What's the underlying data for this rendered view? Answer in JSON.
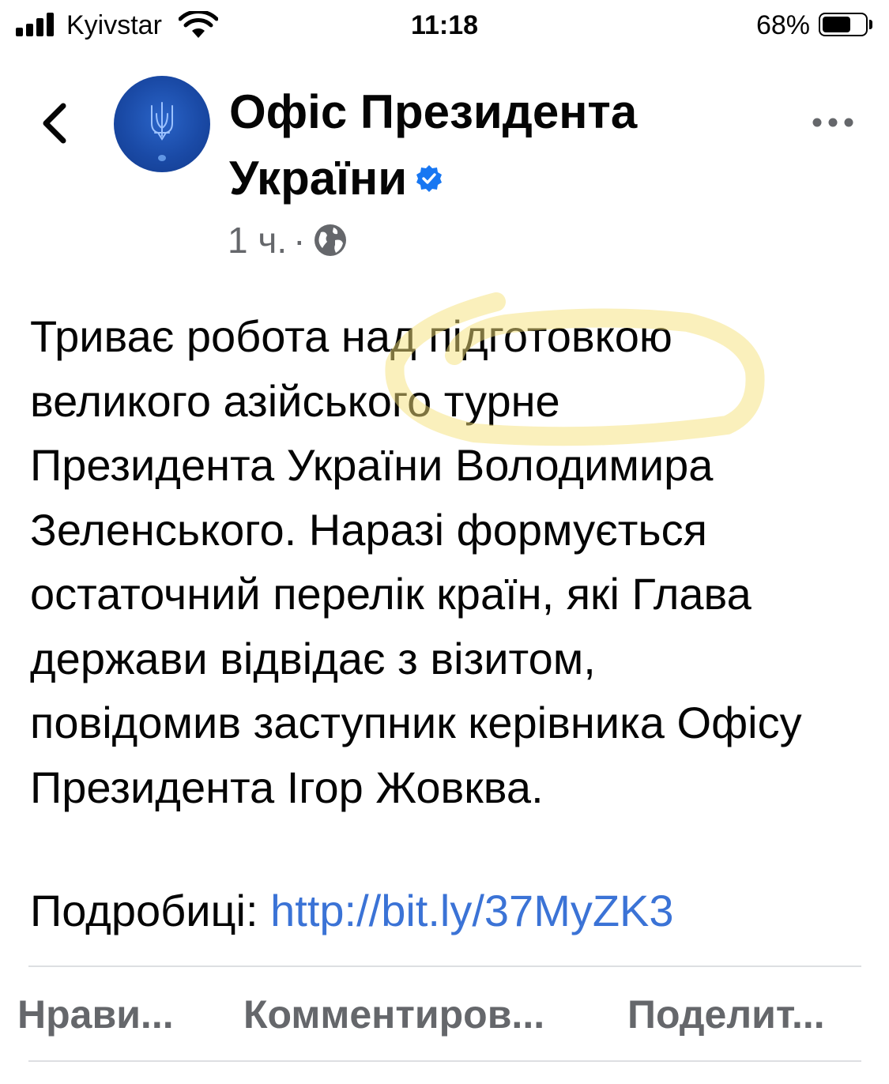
{
  "status_bar": {
    "carrier": "Kyivstar",
    "time": "11:18",
    "battery_percent": "68%",
    "battery_level": 0.68,
    "signal_bars": 4,
    "wifi_icon": "wifi-icon"
  },
  "header": {
    "back_icon": "chevron-left-icon",
    "page_name_line1": "Офіс Президента",
    "page_name_line2": "України",
    "verified_icon": "verified-badge-icon",
    "time_ago": "1 ч.",
    "separator": "·",
    "audience_icon": "globe-icon",
    "more_icon": "more-horizontal-icon"
  },
  "post": {
    "lines": [
      "Триває робота над підготовкою",
      "великого азійського турне",
      "Президента України Володимира",
      "Зеленського. Наразі формується",
      "остаточний перелік країн, які Глава",
      "держави відвідає з візитом,",
      "повідомив заступник керівника Офісу",
      "Президента Ігор Жовква."
    ],
    "details_label": "Подробиці:",
    "link": "http://bit.ly/37MyZK3",
    "highlight_color": "#f6e27a"
  },
  "actions": {
    "like": "Нрави...",
    "comment": "Комментиров...",
    "share": "Поделит..."
  }
}
